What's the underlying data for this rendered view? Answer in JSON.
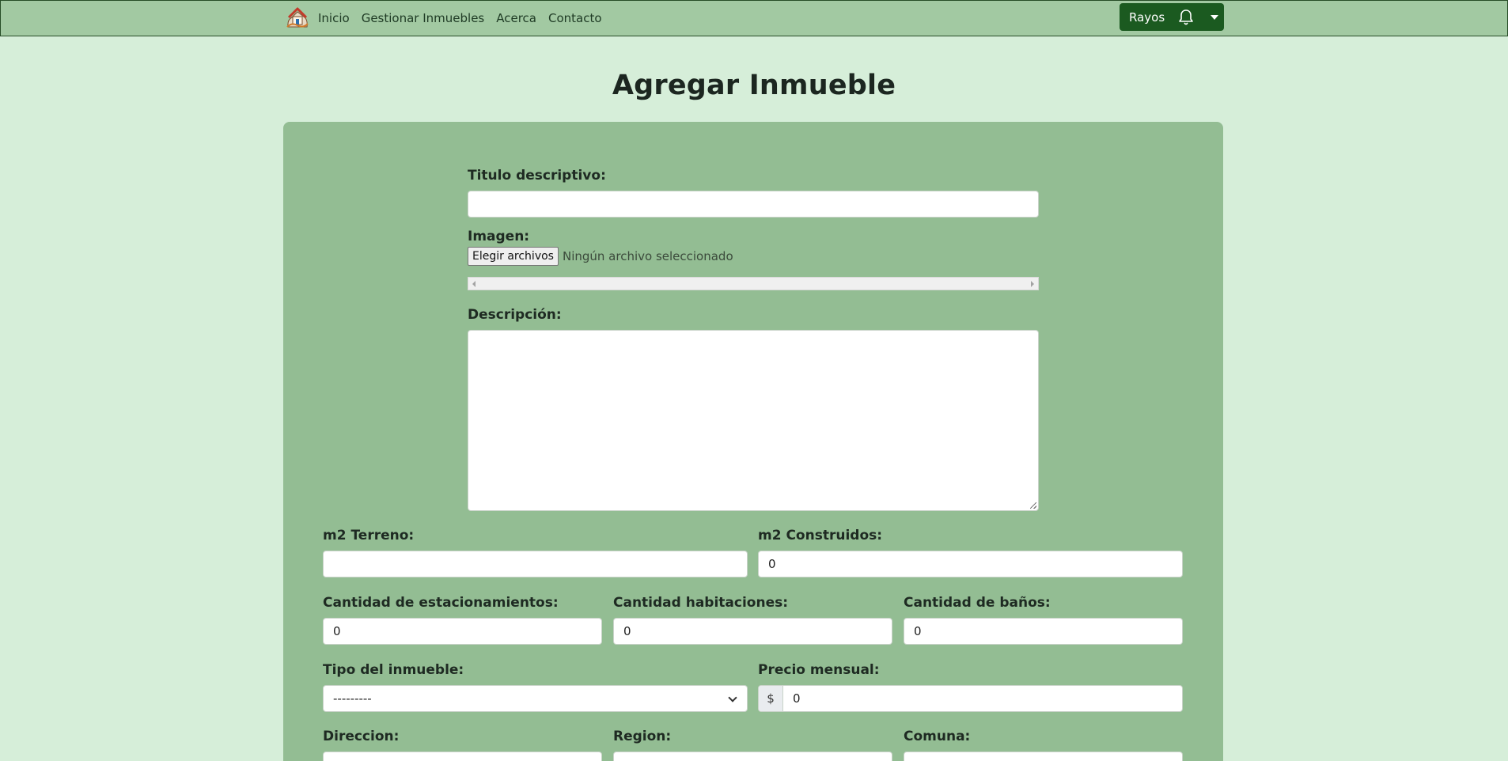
{
  "navbar": {
    "links": [
      "Inicio",
      "Gestionar Inmuebles",
      "Acerca",
      "Contacto"
    ],
    "user_name": "Rayos",
    "bell_icon": "bell-icon",
    "caret_icon": "chevron-down-icon"
  },
  "page": {
    "title": "Agregar Inmueble"
  },
  "form": {
    "titulo_label": "Titulo descriptivo:",
    "titulo_value": "",
    "imagen_label": "Imagen:",
    "file_button": "Elegir archivos",
    "file_status": "Ningún archivo seleccionado",
    "descripcion_label": "Descripción:",
    "m2_terreno_label": "m2 Terreno:",
    "m2_terreno_value": "",
    "m2_construidos_label": "m2 Construidos:",
    "m2_construidos_value": "0",
    "estacionamientos_label": "Cantidad de estacionamientos:",
    "estacionamientos_value": "0",
    "habitaciones_label": "Cantidad habitaciones:",
    "habitaciones_value": "0",
    "banos_label": "Cantidad de baños:",
    "banos_value": "0",
    "tipo_label": "Tipo del inmueble:",
    "tipo_value": "---------",
    "precio_label": "Precio mensual:",
    "precio_prefix": "$",
    "precio_value": "0",
    "direccion_label": "Direccion:",
    "region_label": "Region:",
    "comuna_label": "Comuna:"
  },
  "colors": {
    "page_bg": "#d6eed9",
    "navbar_bg": "#a2c9a2",
    "card_bg": "#93bd93",
    "user_button_bg": "#1b5a20"
  }
}
